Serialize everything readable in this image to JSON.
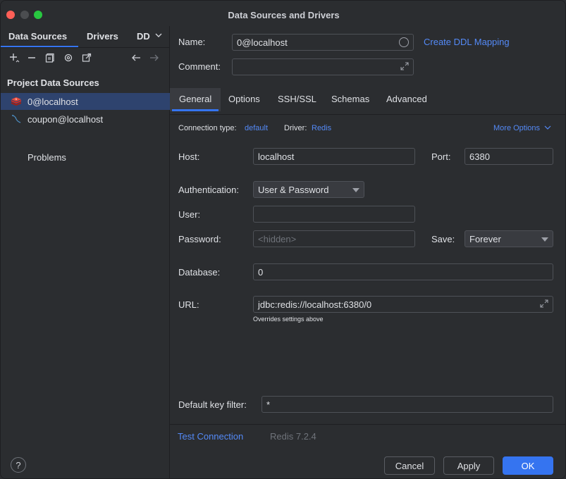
{
  "window": {
    "title": "Data Sources and Drivers"
  },
  "sidebar": {
    "tabs": [
      {
        "label": "Data Sources"
      },
      {
        "label": "Drivers"
      },
      {
        "label": "DD"
      }
    ],
    "section_title": "Project Data Sources",
    "items": [
      {
        "label": "0@localhost",
        "icon": "redis-icon",
        "selected": true
      },
      {
        "label": "coupon@localhost",
        "icon": "mysql-dolphin-icon",
        "selected": false
      }
    ],
    "problems_label": "Problems"
  },
  "form": {
    "name_label": "Name:",
    "name_value": "0@localhost",
    "create_ddl_link": "Create DDL Mapping",
    "comment_label": "Comment:",
    "comment_value": "",
    "tabs": [
      "General",
      "Options",
      "SSH/SSL",
      "Schemas",
      "Advanced"
    ],
    "connection_type_label": "Connection type:",
    "connection_type_value": "default",
    "driver_label": "Driver:",
    "driver_value": "Redis",
    "more_options_label": "More Options",
    "host_label": "Host:",
    "host_value": "localhost",
    "port_label": "Port:",
    "port_value": "6380",
    "auth_label": "Authentication:",
    "auth_value": "User & Password",
    "user_label": "User:",
    "user_value": "",
    "password_label": "Password:",
    "password_placeholder": "<hidden>",
    "save_label": "Save:",
    "save_value": "Forever",
    "database_label": "Database:",
    "database_value": "0",
    "url_label": "URL:",
    "url_value": "jdbc:redis://localhost:6380/0",
    "url_hint": "Overrides settings above",
    "default_key_filter_label": "Default key filter:",
    "default_key_filter_value": "*"
  },
  "footer": {
    "test_connection": "Test Connection",
    "server_version": "Redis 7.2.4",
    "help": "?",
    "cancel": "Cancel",
    "apply": "Apply",
    "ok": "OK"
  },
  "colors": {
    "accent": "#3574f0",
    "link": "#548af7",
    "selection": "#2e436e",
    "redis": "#d82c20"
  }
}
